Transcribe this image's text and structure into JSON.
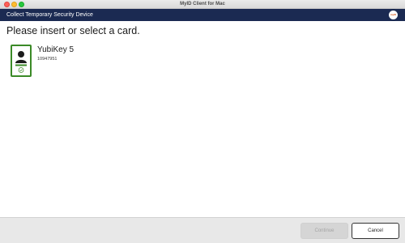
{
  "window": {
    "title": "MyID Client for Mac"
  },
  "header": {
    "title": "Collect Temporary Security Device",
    "logo_text": "myID"
  },
  "main": {
    "prompt": "Please insert or select a card.",
    "cards": [
      {
        "name": "YubiKey 5",
        "serial": "10947951",
        "icon": "person-card-icon",
        "status_icon": "check-circle-icon",
        "selected": true
      }
    ]
  },
  "footer": {
    "continue_label": "Continue",
    "continue_enabled": false,
    "cancel_label": "Cancel"
  },
  "colors": {
    "header_bg": "#1b2a52",
    "card_border": "#3b8a27",
    "footer_bg": "#e8e8e8"
  }
}
